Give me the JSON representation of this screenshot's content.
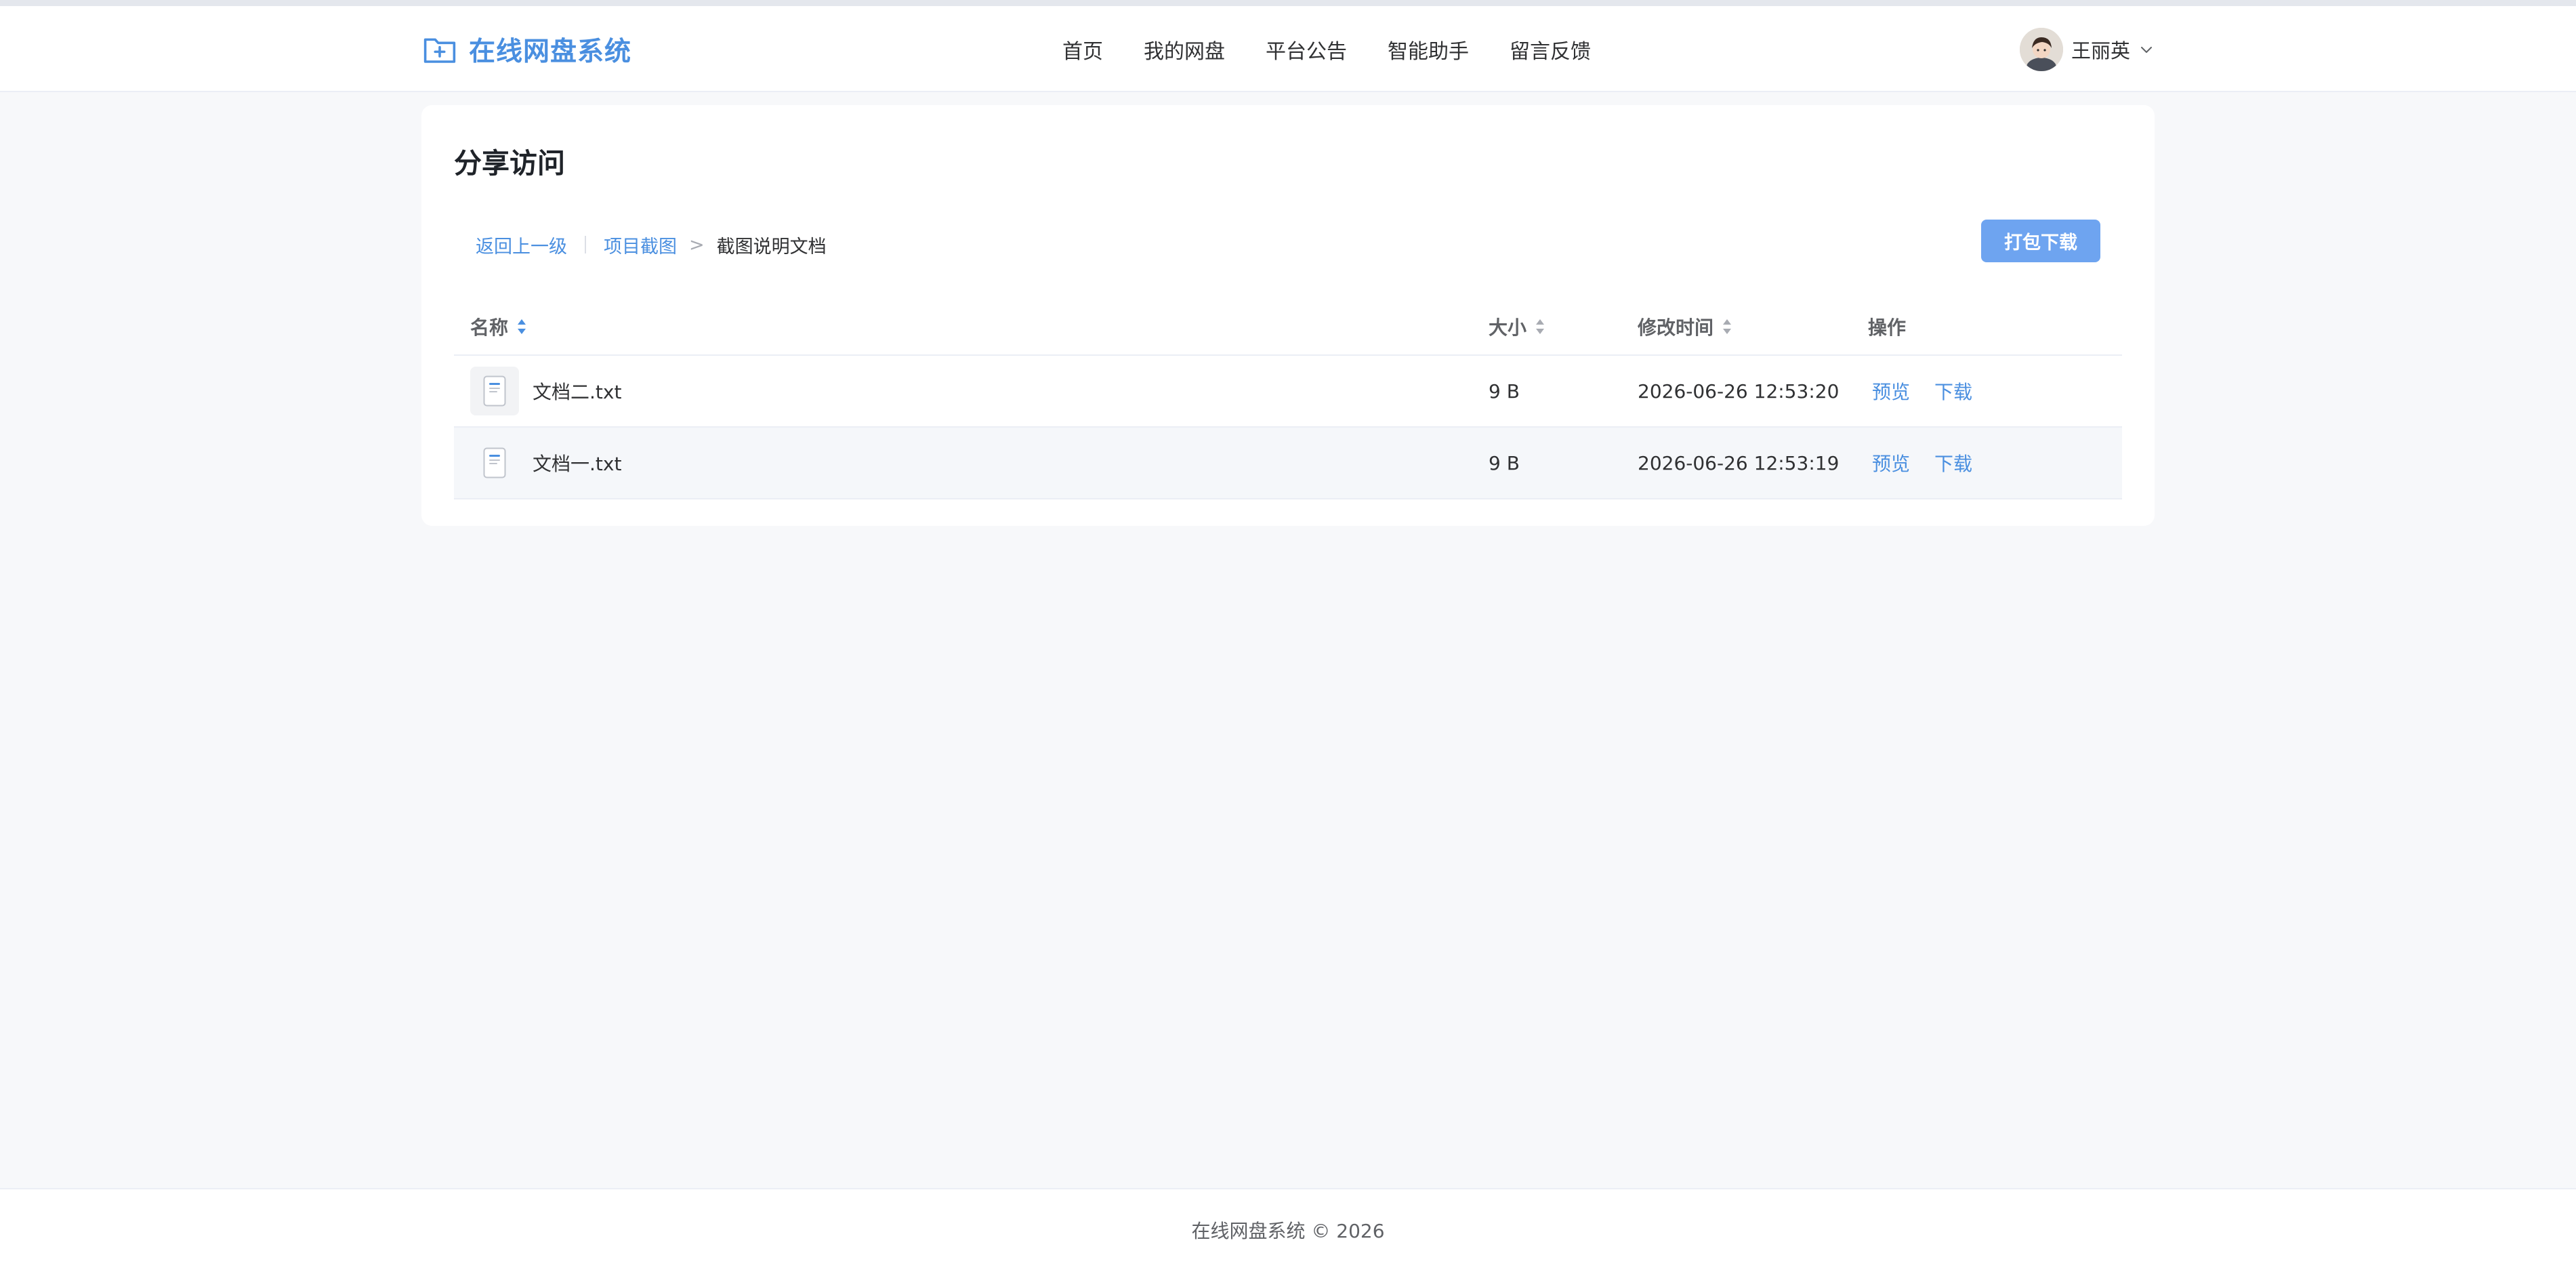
{
  "header": {
    "brand": "在线网盘系统",
    "nav": [
      "首页",
      "我的网盘",
      "平台公告",
      "智能助手",
      "留言反馈"
    ],
    "user_name": "王丽英"
  },
  "main": {
    "title": "分享访问",
    "breadcrumb": {
      "back": "返回上一级",
      "parent": "项目截图",
      "separator": ">",
      "current": "截图说明文档"
    },
    "pack_download_label": "打包下载",
    "table": {
      "columns": [
        "名称",
        "大小",
        "修改时间",
        "操作"
      ],
      "rows": [
        {
          "name": "文档二.txt",
          "size": "9 B",
          "modified": "2026-06-26 12:53:20",
          "preview": "预览",
          "download": "下载"
        },
        {
          "name": "文档一.txt",
          "size": "9 B",
          "modified": "2026-06-26 12:53:19",
          "preview": "预览",
          "download": "下载"
        }
      ]
    }
  },
  "footer": {
    "text": "在线网盘系统 © 2026"
  },
  "colors": {
    "accent": "#4a8fe0",
    "button": "#6ea4f0",
    "background": "#f7f8fa"
  },
  "icons": [
    "folder-plus-icon",
    "avatar",
    "chevron-down-icon",
    "sort-icon",
    "text-file-icon"
  ]
}
